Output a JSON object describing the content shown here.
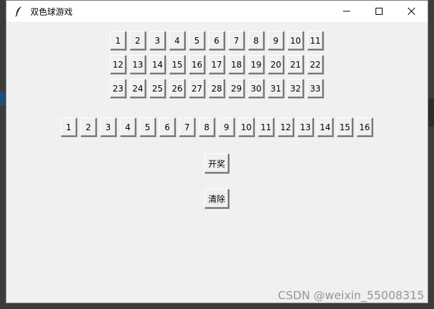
{
  "window": {
    "title": "双色球游戏"
  },
  "red_balls": [
    "1",
    "2",
    "3",
    "4",
    "5",
    "6",
    "7",
    "8",
    "9",
    "10",
    "11",
    "12",
    "13",
    "14",
    "15",
    "16",
    "17",
    "18",
    "19",
    "20",
    "21",
    "22",
    "23",
    "24",
    "25",
    "26",
    "27",
    "28",
    "29",
    "30",
    "31",
    "32",
    "33"
  ],
  "blue_balls": [
    "1",
    "2",
    "3",
    "4",
    "5",
    "6",
    "7",
    "8",
    "9",
    "10",
    "11",
    "12",
    "13",
    "14",
    "15",
    "16"
  ],
  "actions": {
    "draw_label": "开奖",
    "clear_label": "清除"
  },
  "watermark": "CSDN @weixin_55008315",
  "icons": {
    "app": "feather-icon",
    "minimize": "minimize-icon",
    "maximize": "maximize-icon",
    "close": "close-icon"
  }
}
